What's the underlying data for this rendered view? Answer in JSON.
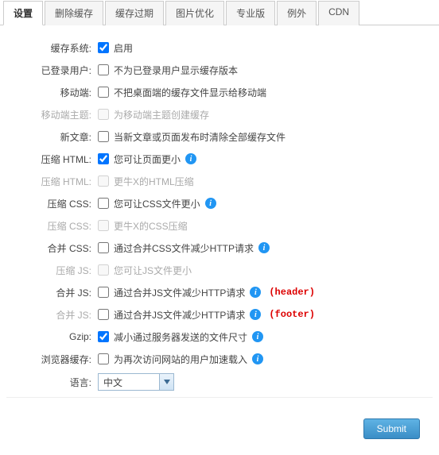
{
  "tabs": {
    "settings": "设置",
    "delete_cache": "删除缓存",
    "cache_expire": "缓存过期",
    "image_opt": "图片优化",
    "pro": "专业版",
    "exception": "例外",
    "cdn": "CDN"
  },
  "rows": {
    "cache_system": {
      "label": "缓存系统:",
      "text": "启用",
      "checked": true
    },
    "logged_in": {
      "label": "已登录用户:",
      "text": "不为已登录用户显示缓存版本",
      "checked": false
    },
    "mobile": {
      "label": "移动端:",
      "text": "不把桌面端的缓存文件显示给移动端",
      "checked": false
    },
    "mobile_theme": {
      "label": "移动端主题:",
      "text": "为移动端主题创建缓存",
      "checked": false,
      "disabled": true
    },
    "new_post": {
      "label": "新文章:",
      "text": "当新文章或页面发布时清除全部缓存文件",
      "checked": false
    },
    "compress_html": {
      "label": "压缩 HTML:",
      "text": "您可让页面更小",
      "checked": true,
      "info": true
    },
    "compress_html2": {
      "label": "压缩 HTML:",
      "text": "更牛X的HTML压缩",
      "checked": false,
      "disabled": true
    },
    "compress_css": {
      "label": "压缩 CSS:",
      "text": "您可让CSS文件更小",
      "checked": false,
      "info": true
    },
    "compress_css2": {
      "label": "压缩 CSS:",
      "text": "更牛X的CSS压缩",
      "checked": false,
      "disabled": true
    },
    "combine_css": {
      "label": "合并 CSS:",
      "text": "通过合并CSS文件减少HTTP请求",
      "checked": false,
      "info": true
    },
    "compress_js": {
      "label": "压缩 JS:",
      "text": "您可让JS文件更小",
      "checked": false,
      "disabled": true
    },
    "combine_js_header": {
      "label": "合并 JS:",
      "text": "通过合并JS文件减少HTTP请求",
      "checked": false,
      "info": true,
      "suffix": "(header)"
    },
    "combine_js_footer": {
      "label": "合并 JS:",
      "text": "通过合并JS文件减少HTTP请求",
      "checked": false,
      "info": true,
      "disabled_label": true,
      "suffix": "(footer)"
    },
    "gzip": {
      "label": "Gzip:",
      "text": "减小通过服务器发送的文件尺寸",
      "checked": true,
      "info": true
    },
    "browser_cache": {
      "label": "浏览器缓存:",
      "text": "为再次访问网站的用户加速载入",
      "checked": false,
      "info": true
    },
    "language": {
      "label": "语言:",
      "value": "中文"
    }
  },
  "submit": "Submit"
}
